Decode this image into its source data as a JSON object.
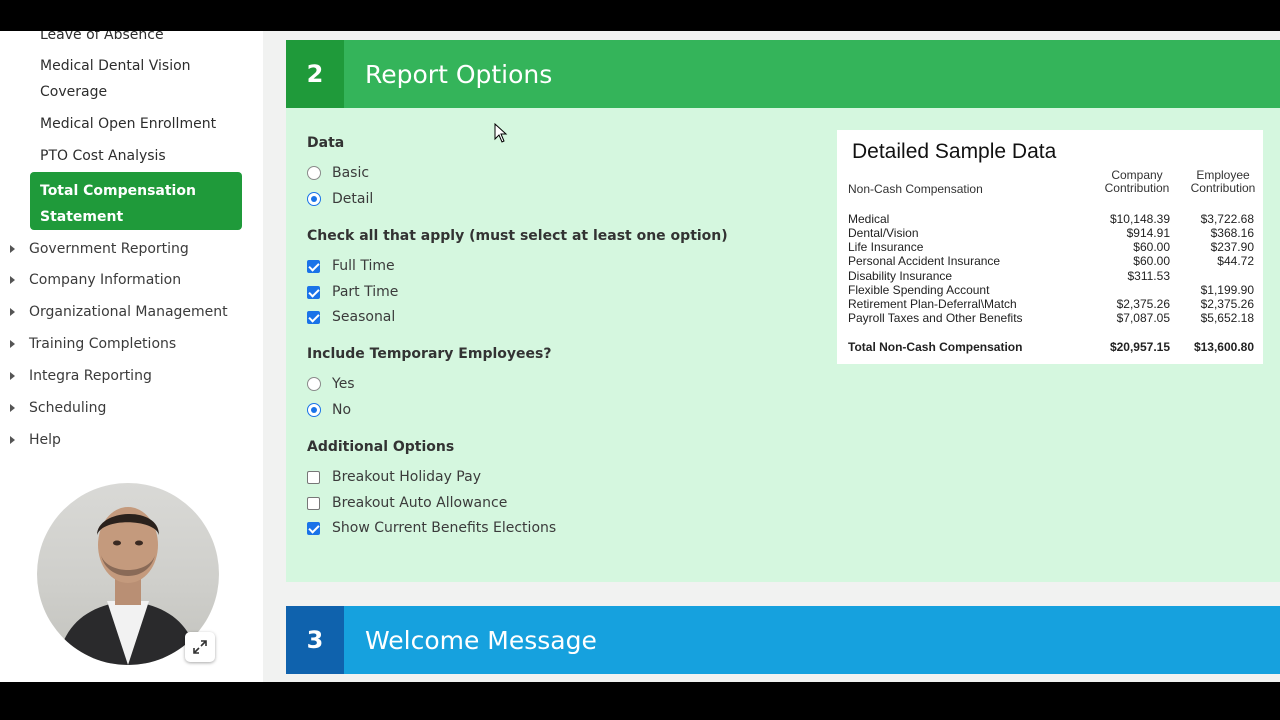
{
  "sidebar": {
    "sub_items": [
      "Leave of Absence",
      "Medical Dental Vision",
      "Coverage",
      "Medical Open Enrollment",
      "PTO Cost Analysis"
    ],
    "active_item": [
      "Total Compensation",
      "Statement"
    ],
    "nav_items": [
      "Government Reporting",
      "Company Information",
      "Organizational Management",
      "Training Completions",
      "Integra Reporting",
      "Scheduling",
      "Help"
    ]
  },
  "section2": {
    "number": "2",
    "title": "Report Options",
    "data_label": "Data",
    "data_options": [
      "Basic",
      "Detail"
    ],
    "data_selected": "Detail",
    "check_label": "Check all that apply (must select at least one option)",
    "check_options": [
      "Full Time",
      "Part Time",
      "Seasonal"
    ],
    "temp_label": "Include Temporary Employees?",
    "temp_options": [
      "Yes",
      "No"
    ],
    "temp_selected": "No",
    "additional_label": "Additional Options",
    "additional_options": [
      "Breakout Holiday Pay",
      "Breakout Auto Allowance",
      "Show Current Benefits Elections"
    ]
  },
  "sample": {
    "title": "Detailed Sample Data",
    "category": "Non-Cash Compensation",
    "company_header": [
      "Company",
      "Contribution"
    ],
    "employee_header": [
      "Employee",
      "Contribution"
    ],
    "rows": [
      {
        "name": "Medical",
        "company": "$10,148.39",
        "employee": "$3,722.68"
      },
      {
        "name": "Dental/Vision",
        "company": "$914.91",
        "employee": "$368.16"
      },
      {
        "name": "Life Insurance",
        "company": "$60.00",
        "employee": "$237.90"
      },
      {
        "name": "Personal Accident Insurance",
        "company": "$60.00",
        "employee": "$44.72"
      },
      {
        "name": "Disability Insurance",
        "company": "$311.53",
        "employee": ""
      },
      {
        "name": "Flexible Spending Account",
        "company": "",
        "employee": "$1,199.90"
      },
      {
        "name": "Retirement Plan-Deferral\\Match",
        "company": "$2,375.26",
        "employee": "$2,375.26"
      },
      {
        "name": "Payroll Taxes and Other Benefits",
        "company": "$7,087.05",
        "employee": "$5,652.18"
      }
    ],
    "total": {
      "name": "Total Non-Cash Compensation",
      "company": "$20,957.15",
      "employee": "$13,600.80"
    }
  },
  "section3": {
    "number": "3",
    "title": "Welcome Message"
  },
  "colors": {
    "green_header": "#34b45a",
    "green_number": "#1f9a3a",
    "panel_bg": "#d5f7df",
    "blue_header": "#16a1de",
    "blue_number": "#0f62ad",
    "checkbox": "#1a73e8"
  }
}
